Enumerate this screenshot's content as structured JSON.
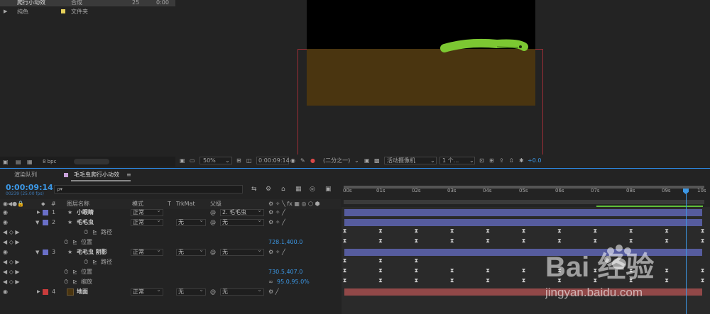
{
  "project": {
    "rows": [
      {
        "name": "爬行小动效",
        "type": "合成",
        "num": "25",
        "extra": "0:00",
        "color": "#c7a1d9",
        "highlight": true
      },
      {
        "name": "纯色",
        "type": "文件夹",
        "num": "",
        "extra": "",
        "color": "#e5d05a",
        "highlight": false
      }
    ],
    "bpc": "8 bpc"
  },
  "viewer": {
    "zoom": "50%",
    "timecode": "0:00:09:14",
    "resolution": "(二分之一)",
    "camera": "活动摄像机",
    "views": "1 个...",
    "exposure": "+0.0"
  },
  "timeline": {
    "tabs": [
      "渲染队列",
      "毛毛虫爬行小动效"
    ],
    "timecode": "0:00:09:14",
    "fps": "00239 (25.00 fps)",
    "search_placeholder": "ρ▾",
    "headers": {
      "hash": "#",
      "name": "图层名称",
      "mode": "模式",
      "t": "T",
      "trkmat": "TrkMat",
      "parent": "父级"
    },
    "ruler": [
      "00s",
      "01s",
      "02s",
      "03s",
      "04s",
      "05s",
      "06s",
      "07s",
      "08s",
      "09s",
      "10s"
    ],
    "layers": [
      {
        "num": "1",
        "name": "小眼睛",
        "mode": "正常",
        "trkmat": "",
        "parent": "2. 毛毛虫",
        "color": "#6a6fc8"
      },
      {
        "num": "2",
        "name": "毛毛虫",
        "mode": "正常",
        "trkmat": "无",
        "parent": "无",
        "color": "#6a6fc8"
      },
      {
        "prop": "路径"
      },
      {
        "prop": "位置",
        "value": "728.1,400.0"
      },
      {
        "num": "3",
        "name": "毛毛虫 阴影",
        "mode": "正常",
        "trkmat": "无",
        "parent": "无",
        "color": "#6a6fc8"
      },
      {
        "prop": "路径"
      },
      {
        "prop": "位置",
        "value": "730.5,407.0"
      },
      {
        "prop": "缩放",
        "value": "95.0,95.0%"
      },
      {
        "num": "4",
        "name": "地面",
        "mode": "正常",
        "trkmat": "无",
        "parent": "无",
        "color": "#c93c3c"
      }
    ],
    "bar_colors": {
      "purple": "#565c9e",
      "red": "#914848"
    }
  },
  "watermark": {
    "brand": "Bai  经验",
    "url": "jingyan.baidu.com"
  }
}
